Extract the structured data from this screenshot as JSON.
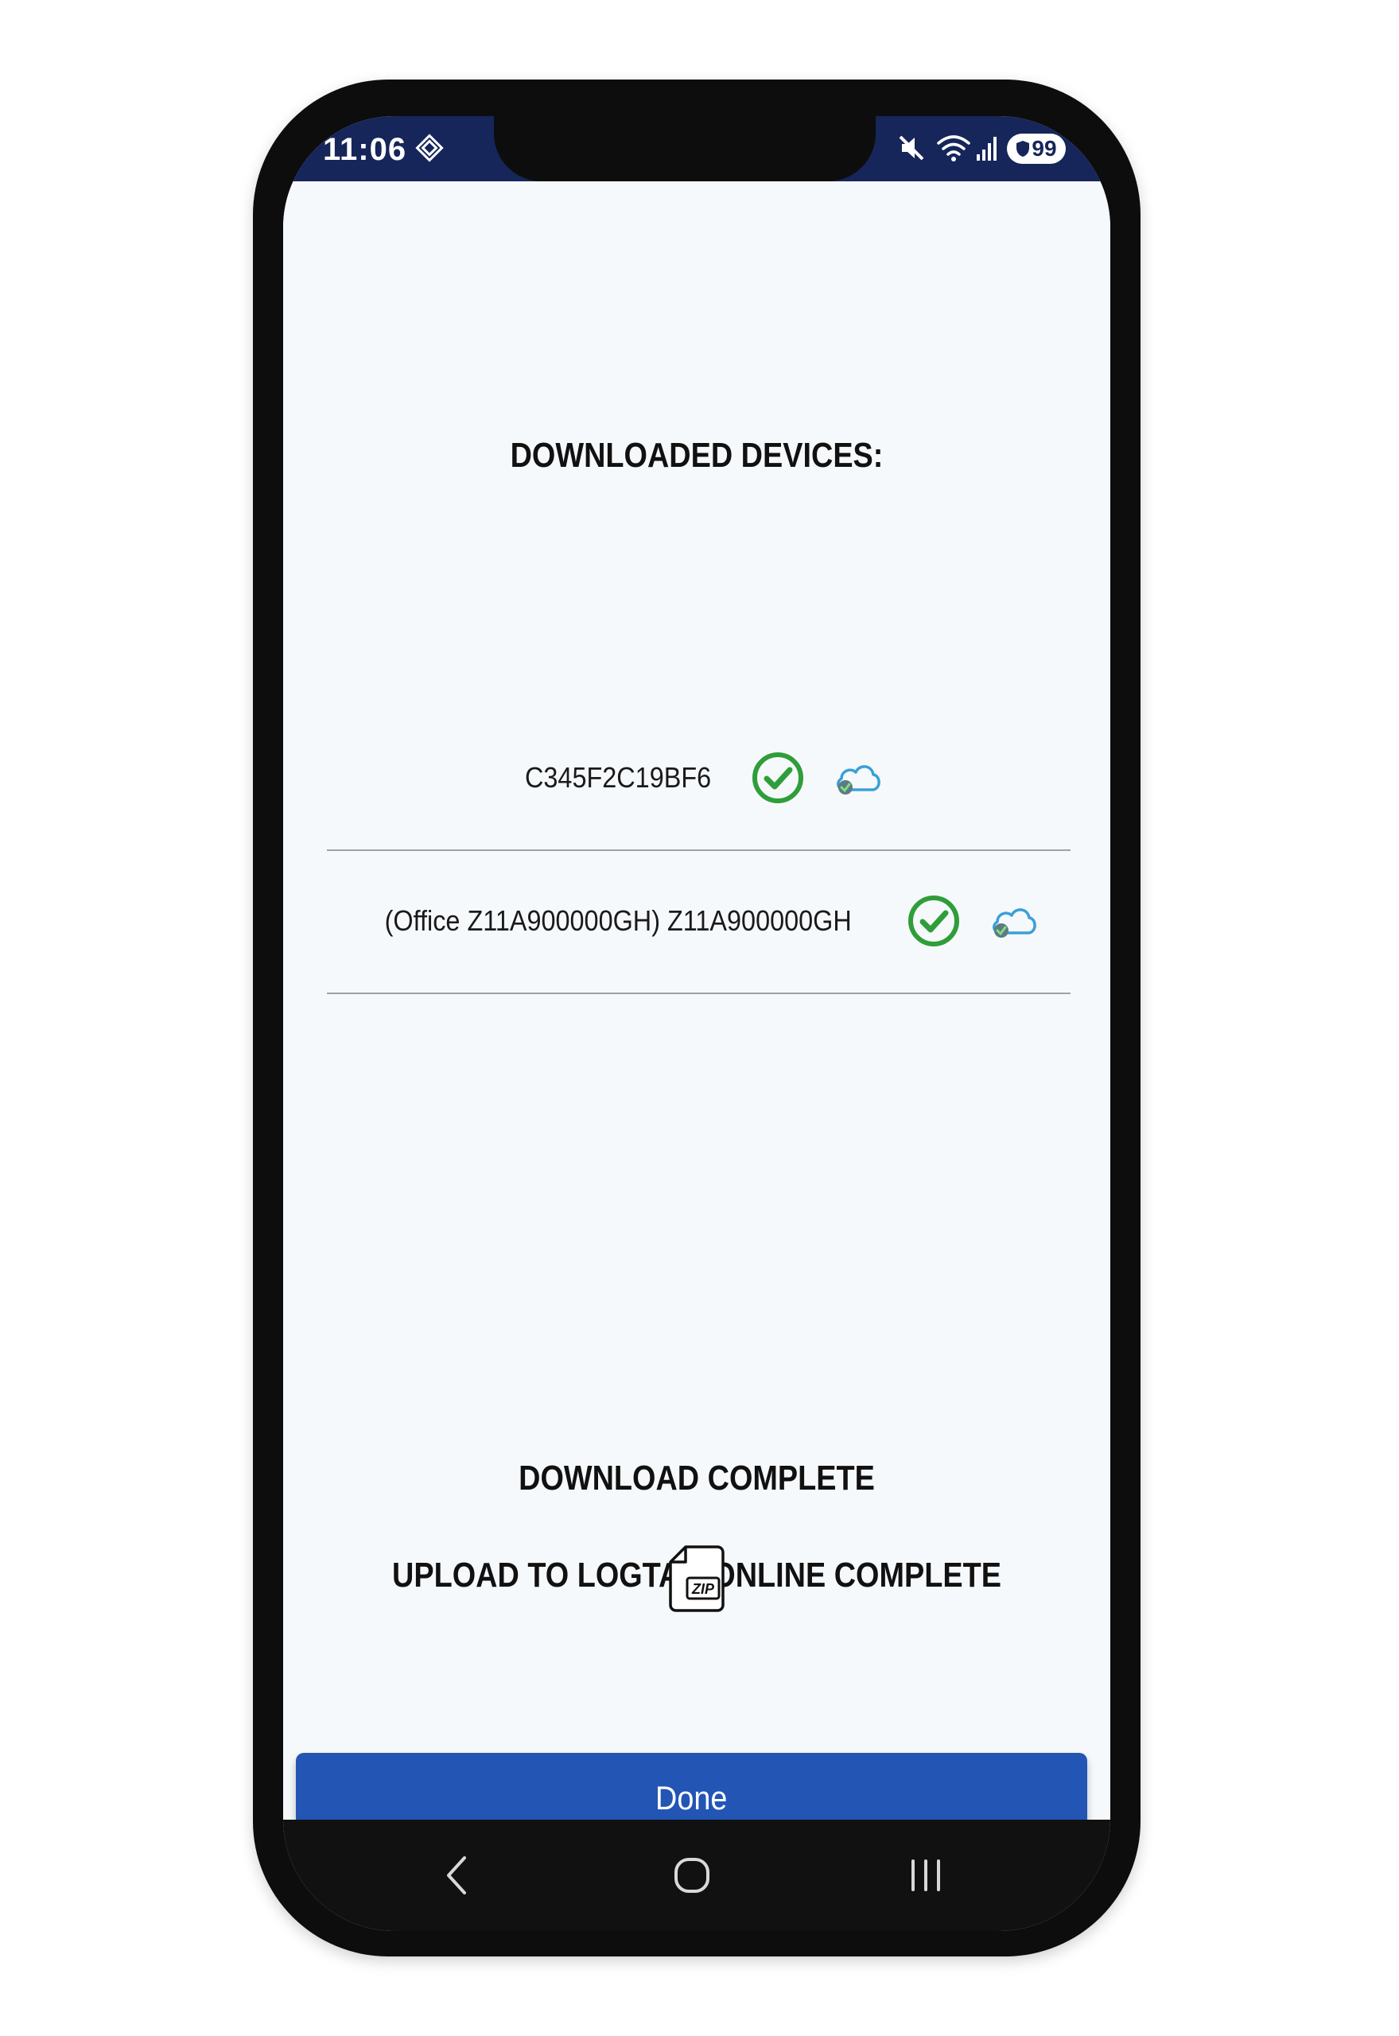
{
  "status_bar": {
    "time": "11:06",
    "battery": "99"
  },
  "header": {
    "title": "DOWNLOADED DEVICES:"
  },
  "devices": [
    {
      "label": "C345F2C19BF6"
    },
    {
      "label": "(Office Z11A900000GH) Z11A900000GH"
    }
  ],
  "status": {
    "download": "DOWNLOAD COMPLETE",
    "upload": "UPLOAD TO LOGTAG ONLINE COMPLETE"
  },
  "icons": {
    "zip_text": "ZIP"
  },
  "colors": {
    "accent": "#2355b5",
    "status_bar": "#16265a",
    "success": "#2f9e3a",
    "cloud": "#3aa0d8"
  },
  "footer": {
    "done_label": "Done"
  }
}
